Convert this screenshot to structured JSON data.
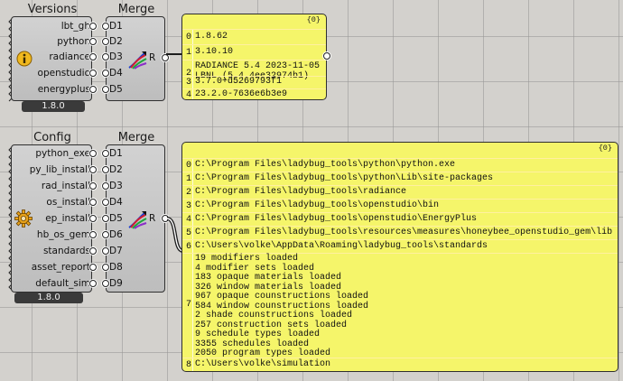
{
  "versions": {
    "title": "Versions",
    "outputs": [
      "lbt_gh",
      "python",
      "radiance",
      "openstudio",
      "energyplus"
    ],
    "version": "1.8.0",
    "icon": "info-icon"
  },
  "merge1": {
    "title": "Merge",
    "inputs": [
      "D1",
      "D2",
      "D3",
      "D4",
      "D5"
    ],
    "output": "R"
  },
  "panel1": {
    "path": "{0}",
    "rows": [
      {
        "index": "0",
        "lines": [
          "1.8.62"
        ]
      },
      {
        "index": "1",
        "lines": [
          "3.10.10"
        ]
      },
      {
        "index": "2",
        "lines": [
          "RADIANCE 5.4 2023-11-05",
          "LBNL (5.4.4ee32974b1)"
        ]
      },
      {
        "index": "3",
        "lines": [
          "3.7.0+d5269793f1"
        ]
      },
      {
        "index": "4",
        "lines": [
          "23.2.0-7636e6b3e9"
        ]
      }
    ]
  },
  "config": {
    "title": "Config",
    "outputs": [
      "python_exe",
      "py_lib_install",
      "rad_install",
      "os_install",
      "ep_install",
      "hb_os_gem",
      "standards",
      "asset_report",
      "default_sim"
    ],
    "version": "1.8.0",
    "icon": "gear-icon"
  },
  "merge2": {
    "title": "Merge",
    "inputs": [
      "D1",
      "D2",
      "D3",
      "D4",
      "D5",
      "D6",
      "D7",
      "D8",
      "D9"
    ],
    "output": "R"
  },
  "panel2": {
    "path": "{0}",
    "rows": [
      {
        "index": "0",
        "lines": [
          "C:\\Program Files\\ladybug_tools\\python\\python.exe"
        ]
      },
      {
        "index": "1",
        "lines": [
          "C:\\Program Files\\ladybug_tools\\python\\Lib\\site-packages"
        ]
      },
      {
        "index": "2",
        "lines": [
          "C:\\Program Files\\ladybug_tools\\radiance"
        ]
      },
      {
        "index": "3",
        "lines": [
          "C:\\Program Files\\ladybug_tools\\openstudio\\bin"
        ]
      },
      {
        "index": "4",
        "lines": [
          "C:\\Program Files\\ladybug_tools\\openstudio\\EnergyPlus"
        ]
      },
      {
        "index": "5",
        "lines": [
          "C:\\Program Files\\ladybug_tools\\resources\\measures\\honeybee_openstudio_gem\\lib"
        ]
      },
      {
        "index": "6",
        "lines": [
          "C:\\Users\\volke\\AppData\\Roaming\\ladybug_tools\\standards"
        ]
      },
      {
        "index": "7",
        "lines": [
          "19 modifiers loaded",
          "4 modifier sets loaded",
          "183 opaque materials loaded",
          "326 window materials loaded",
          "967 opaque counstructions loaded",
          "584 window counstructions loaded",
          "2 shade counstructions loaded",
          "257 construction sets loaded",
          "9 schedule types loaded",
          "3355 schedules loaded",
          "2050 program types loaded"
        ]
      },
      {
        "index": "8",
        "lines": [
          "C:\\Users\\volke\\simulation"
        ]
      }
    ]
  }
}
